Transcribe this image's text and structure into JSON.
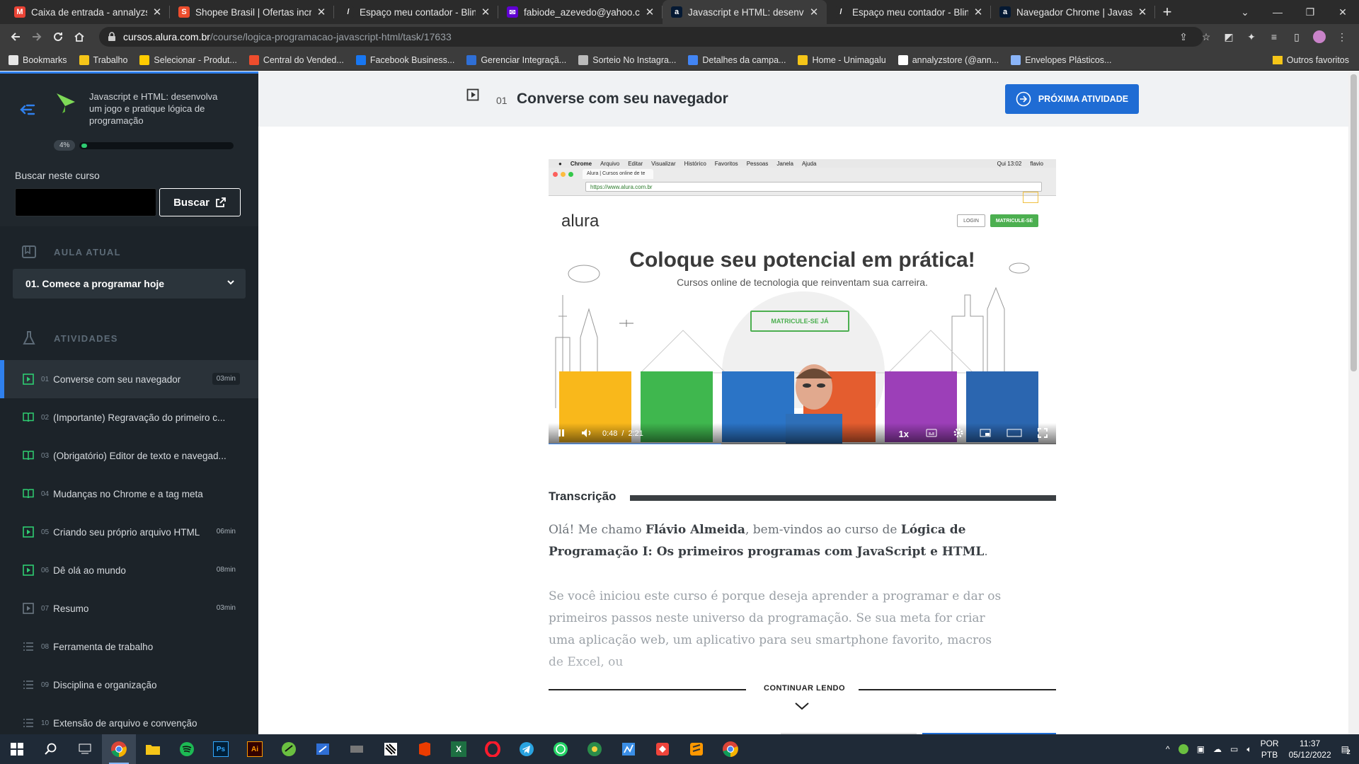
{
  "tabs": [
    {
      "title": "Caixa de entrada - annalyzstore@",
      "favicon_color": "#ea4335",
      "favicon_letter": "M",
      "active": false
    },
    {
      "title": "Shopee Brasil | Ofertas incríveis.",
      "favicon_color": "#ee4d2d",
      "favicon_letter": "S",
      "active": false
    },
    {
      "title": "Espaço meu contador - Bling",
      "favicon_color": "#2b2b2b",
      "favicon_letter": "/",
      "active": false
    },
    {
      "title": "fabiode_azevedo@yahoo.com.b",
      "favicon_color": "#6001d2",
      "favicon_letter": "✉",
      "active": false
    },
    {
      "title": "Javascript e HTML: desenvol",
      "favicon_color": "#051933",
      "favicon_letter": "a",
      "active": true
    },
    {
      "title": "Espaço meu contador - Bling",
      "favicon_color": "#2b2b2b",
      "favicon_letter": "/",
      "active": false
    },
    {
      "title": "Navegador Chrome | Javascript",
      "favicon_color": "#051933",
      "favicon_letter": "a",
      "active": false
    }
  ],
  "address": {
    "host": "cursos.alura.com.br",
    "path": "/course/logica-programacao-javascript-html/task/17633"
  },
  "bookmarks": [
    {
      "label": "Bookmarks",
      "color": "#e6e6e6"
    },
    {
      "label": "Trabalho",
      "color": "#f5c518"
    },
    {
      "label": "Selecionar - Produt...",
      "color": "#ffcc00"
    },
    {
      "label": "Central do Vended...",
      "color": "#ee4d2d"
    },
    {
      "label": "Facebook Business...",
      "color": "#1877f2"
    },
    {
      "label": "Gerenciar Integraçã...",
      "color": "#2f6fd6"
    },
    {
      "label": "Sorteio No Instagra...",
      "color": "#bbbbbb"
    },
    {
      "label": "Detalhes da campa...",
      "color": "#4285f4"
    },
    {
      "label": "Home - Unimagalu",
      "color": "#f5c518"
    },
    {
      "label": "annalyzstore (@ann...",
      "color": "#ffffff"
    },
    {
      "label": "Envelopes Plásticos...",
      "color": "#8ab4f8"
    }
  ],
  "bookmarks_other": "Outros favoritos",
  "sidebar": {
    "course_title": "Javascript e HTML: desenvolva um jogo e pratique lógica de programação",
    "progress_label": "4%",
    "progress_value": 0.04,
    "search_label": "Buscar neste curso",
    "search_placeholder": "",
    "search_button": "Buscar",
    "current_lesson_header": "AULA ATUAL",
    "current_lesson": "01. Comece a programar hoje",
    "activities_header": "ATIVIDADES",
    "activities": [
      {
        "num": "01",
        "name": "Converse com seu navegador",
        "duration": "03min",
        "icon": "video",
        "active": true
      },
      {
        "num": "02",
        "name": "(Importante) Regravação do primeiro c...",
        "duration": "",
        "icon": "book",
        "active": false
      },
      {
        "num": "03",
        "name": "(Obrigatório) Editor de texto e navegad...",
        "duration": "",
        "icon": "book",
        "active": false
      },
      {
        "num": "04",
        "name": "Mudanças no Chrome e a tag meta",
        "duration": "",
        "icon": "book",
        "active": false
      },
      {
        "num": "05",
        "name": "Criando seu próprio arquivo HTML",
        "duration": "06min",
        "icon": "video",
        "active": false
      },
      {
        "num": "06",
        "name": "Dê olá ao mundo",
        "duration": "08min",
        "icon": "video",
        "active": false
      },
      {
        "num": "07",
        "name": "Resumo",
        "duration": "03min",
        "icon": "video-gray",
        "active": false
      },
      {
        "num": "08",
        "name": "Ferramenta de trabalho",
        "duration": "",
        "icon": "list",
        "active": false
      },
      {
        "num": "09",
        "name": "Disciplina e organização",
        "duration": "",
        "icon": "list",
        "active": false
      },
      {
        "num": "10",
        "name": "Extensão de arquivo e convenção",
        "duration": "",
        "icon": "list",
        "active": false
      }
    ]
  },
  "task": {
    "num": "01",
    "title": "Converse com seu navegador",
    "next_button": "PRÓXIMA ATIVIDADE"
  },
  "video": {
    "menu": [
      "Chrome",
      "Arquivo",
      "Editar",
      "Visualizar",
      "Histórico",
      "Favoritos",
      "Pessoas",
      "Janela",
      "Ajuda"
    ],
    "menu_right": [
      "Qui 13:02",
      "flavio"
    ],
    "inner_tab": "Alura | Cursos online de te",
    "inner_url": "https://www.alura.com.br",
    "logo": "alura",
    "login": "LOGIN",
    "matricule": "MATRICULE-SE",
    "headline": "Coloque seu potencial em prática!",
    "subheadline": "Cursos online de tecnologia que reinventam sua carreira.",
    "cta": "MATRICULE-SE JÁ",
    "current_time": "0:48",
    "total_time": "2:21",
    "speed": "1x",
    "progress": 0.34
  },
  "transcript": {
    "header": "Transcrição",
    "p1_a": "Olá! Me chamo ",
    "p1_name": "Flávio Almeida",
    "p1_b": ", bem-vindos ao curso de ",
    "p1_course": "Lógica de Programação I: Os primeiros programas com JavaScript e HTML",
    "p1_c": ".",
    "p2": "Se você iniciou este curso é porque deseja aprender a programar e dar os primeiros passos neste universo da programação. Se sua meta for criar uma aplicação web, um aplicativo para seu smartphone favorito, macros de Excel, ou",
    "continue": "CONTINUAR LENDO"
  },
  "taskbar": {
    "lang": "POR",
    "layout": "PTB",
    "time": "11:37",
    "date": "05/12/2022",
    "notifications": "2"
  }
}
